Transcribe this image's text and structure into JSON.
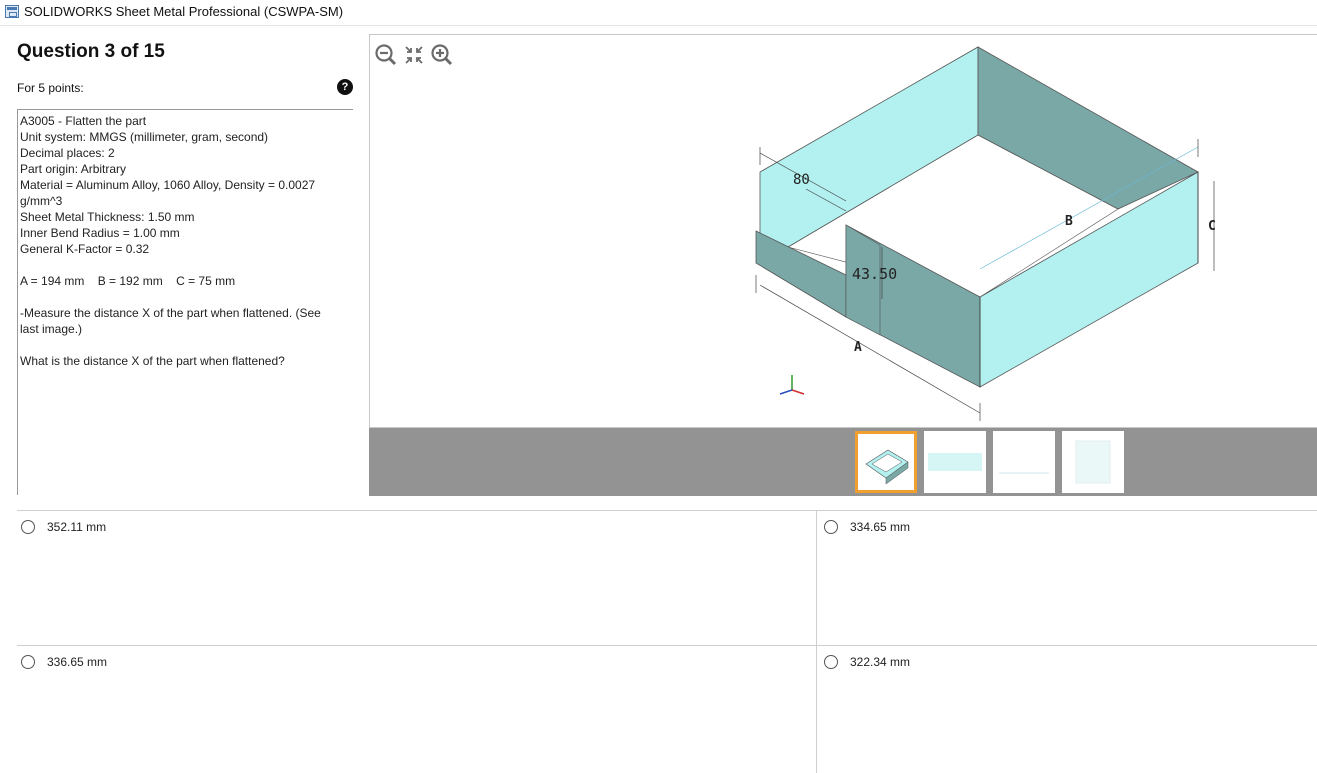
{
  "window": {
    "title": "SOLIDWORKS Sheet Metal Professional (CSWPA-SM)"
  },
  "question": {
    "title": "Question 3 of 15",
    "points": "For 5 points:",
    "lines": [
      "A3005 - Flatten the part",
      "Unit system: MMGS (millimeter, gram, second)",
      "Decimal places: 2",
      "Part origin: Arbitrary",
      "Material = Aluminum Alloy, 1060 Alloy, Density = 0.0027",
      "g/mm^3",
      "Sheet Metal Thickness: 1.50 mm",
      "Inner Bend Radius = 1.00 mm",
      "General K-Factor = 0.32",
      "",
      "A = 194 mm    B = 192 mm    C = 75 mm",
      "",
      "-Measure the distance X of the part when flattened. (See",
      "last image.)",
      "",
      "What is the distance X of the part when flattened?"
    ]
  },
  "viewer": {
    "tools": [
      "zoom-out-icon",
      "fit-to-window-icon",
      "zoom-in-icon"
    ],
    "dims": {
      "d80": "80",
      "d4350": "43.50",
      "a": "A",
      "b": "B",
      "c": "C"
    }
  },
  "thumbnails": [
    {
      "name": "thumbnail-1",
      "active": true
    },
    {
      "name": "thumbnail-2",
      "active": false
    },
    {
      "name": "thumbnail-3",
      "active": false
    },
    {
      "name": "thumbnail-4",
      "active": false
    }
  ],
  "answers": [
    {
      "label": "352.11 mm"
    },
    {
      "label": "334.65 mm"
    },
    {
      "label": "336.65 mm"
    },
    {
      "label": "322.34 mm"
    }
  ],
  "colors": {
    "face_light": "#b3f0f0",
    "face_dark": "#7aa8a6",
    "thumb_active": "#f0a030",
    "thumbbar": "#939393"
  }
}
